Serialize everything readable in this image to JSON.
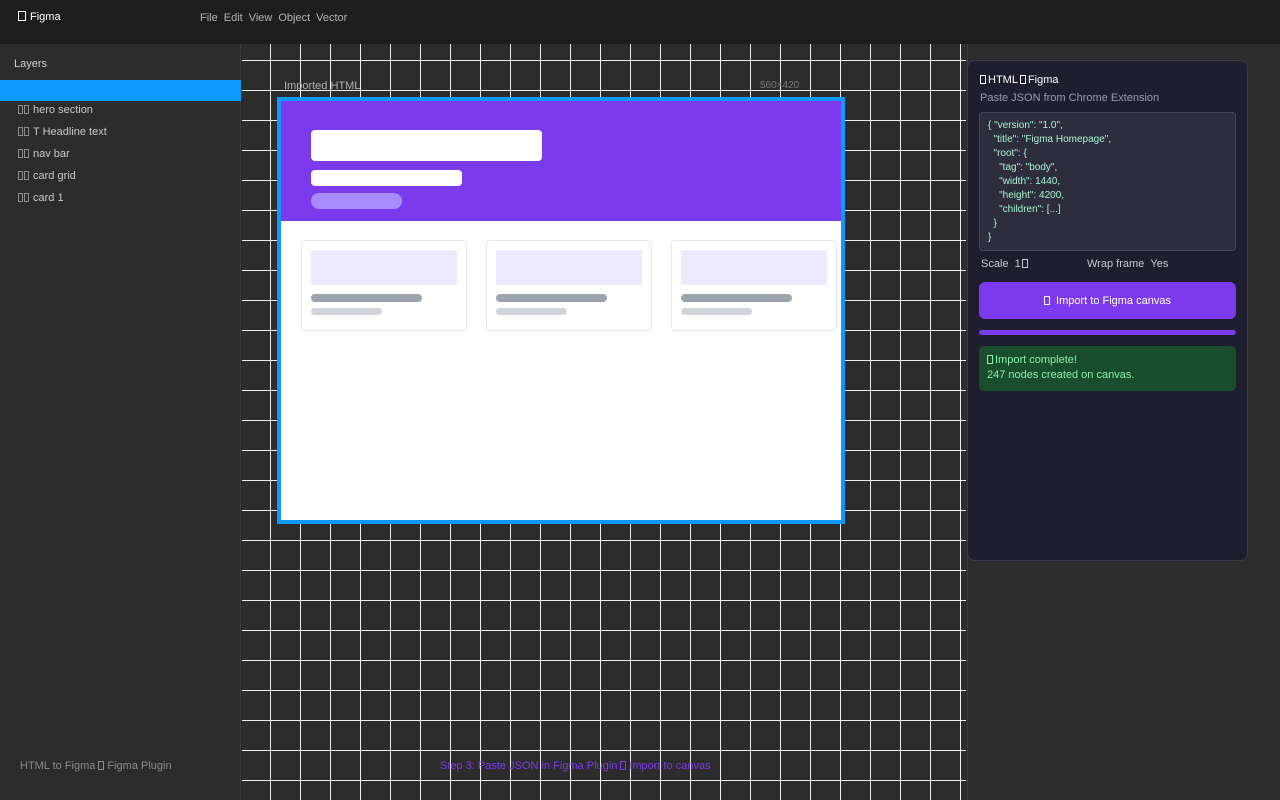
{
  "app": {
    "name": "Figma"
  },
  "menu": [
    "File",
    "Edit",
    "View",
    "Object",
    "Vector"
  ],
  "layers": {
    "title": "Layers",
    "selected_label": "",
    "items": [
      {
        "label": "hero section",
        "icon": "frame-icon"
      },
      {
        "label": "T Headline text",
        "icon": "text-icon"
      },
      {
        "label": "nav bar",
        "icon": "frame-icon"
      },
      {
        "label": "card grid",
        "icon": "frame-icon"
      },
      {
        "label": "card 1",
        "icon": "frame-icon"
      }
    ],
    "footer_left": "HTML to Figma",
    "footer_right": "Figma Plugin"
  },
  "canvas": {
    "frame_label": "Imported HTML",
    "frame_size": "560×420",
    "footer_step": "Step 3: Paste JSON in Figma Plugin",
    "footer_action": "Import to canvas"
  },
  "plugin": {
    "title_left": "HTML",
    "title_right": "Figma",
    "subtitle": "Paste JSON from Chrome Extension",
    "json_lines": [
      "{ \"version\": \"1.0\",",
      "  \"title\": \"Figma Homepage\",",
      "  \"root\": {",
      "    \"tag\": \"body\",",
      "    \"width\": 1440,",
      "    \"height\": 4200,",
      "    \"children\": [...]",
      "  }",
      "}"
    ],
    "scale_label": "Scale",
    "scale_value": "1",
    "wrap_label": "Wrap frame",
    "wrap_value": "Yes",
    "import_button": "Import to Figma canvas",
    "progress": 1.0,
    "success_title": "Import complete!",
    "success_detail": "247 nodes created on canvas."
  },
  "colors": {
    "accent": "#7c3aed",
    "selection": "#0d99ff",
    "success_bg": "#1a4d2e",
    "success_text": "#86efac"
  }
}
